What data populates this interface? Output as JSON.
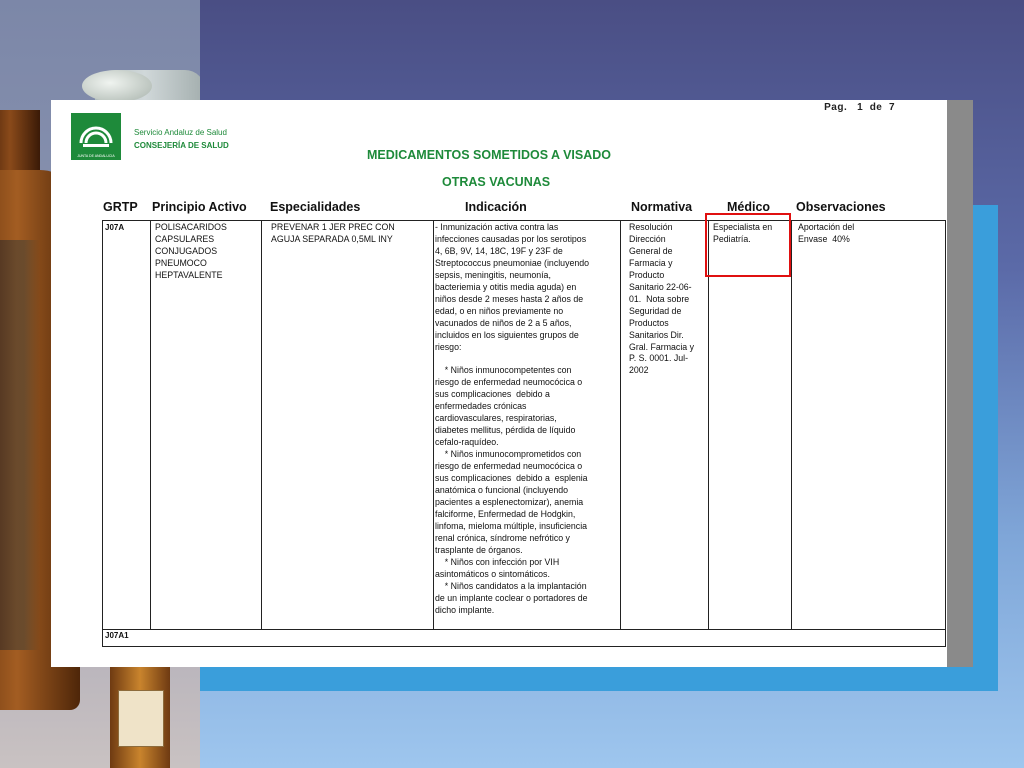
{
  "page": {
    "label": "Pag.",
    "current": "1",
    "of": "de",
    "total": "7"
  },
  "header": {
    "org_line1": "Servicio Andaluz de Salud",
    "org_line2": "CONSEJERÍA DE SALUD",
    "logo_text": "JUNTA DE ANDALUCIA",
    "title": "MEDICAMENTOS SOMETIDOS A VISADO",
    "subtitle": "OTRAS VACUNAS"
  },
  "columns": [
    "GRTP",
    "Principio Activo",
    "Especialidades",
    "Indicación",
    "Normativa",
    "Médico",
    "Observaciones"
  ],
  "row": {
    "grtp": "J07A",
    "principio": "POLISACARIDOS\nCAPSULARES\nCONJUGADOS\nPNEUMOCO\nHEPTAVALENTE",
    "especialidades": "PREVENAR 1 JER PREC CON\nAGUJA SEPARADA 0,5ML INY",
    "indicacion": "- Inmunización activa contra las\ninfecciones causadas por los serotipos\n4, 6B, 9V, 14, 18C, 19F y 23F de\nStreptococcus pneumoniae (incluyendo\nsepsis, meningitis, neumonía,\nbacteriemia y otitis media aguda) en\nniños desde 2 meses hasta 2 años de\nedad, o en niños previamente no\nvacunados de niños de 2 a 5 años,\nincluidos en los siguientes grupos de\nriesgo:\n\n    * Niños inmunocompetentes con\nriesgo de enfermedad neumocócica o\nsus complicaciones  debido a\nenfermedades crónicas\ncardiovasculares, respiratorias,\ndiabetes mellitus, pérdida de líquido\ncefalo-raquídeo.\n    * Niños inmunocomprometidos con\nriesgo de enfermedad neumocócica o\nsus complicaciones  debido a  esplenia\nanatómica o funcional (incluyendo\npacientes a esplenectomizar), anemia\nfalciforme, Enfermedad de Hodgkin,\nlinfoma, mieloma múltiple, insuficiencia\nrenal crónica, síndrome nefrótico y\ntrasplante de órganos.\n    * Niños con infección por VIH\nasintomáticos o sintomáticos.\n    * Niños candidatos a la implantación\nde un implante coclear o portadores de\ndicho implante.",
    "normativa": "Resolución\nDirección\nGeneral de\nFarmacia y\nProducto\nSanitario 22-06-\n01.  Nota sobre\nSeguridad de\nProductos\nSanitarios Dir.\nGral. Farmacia y\nP. S. 0001. Jul-\n2002",
    "medico": "Especialista en\nPediatría.",
    "observaciones": "Aportación del\nEnvase  40%"
  },
  "row2": {
    "grtp": "J07A1"
  },
  "colors": {
    "brand_green": "#1e8a3a",
    "highlight_red": "#e01010",
    "panel_blue": "#3a9edb"
  }
}
